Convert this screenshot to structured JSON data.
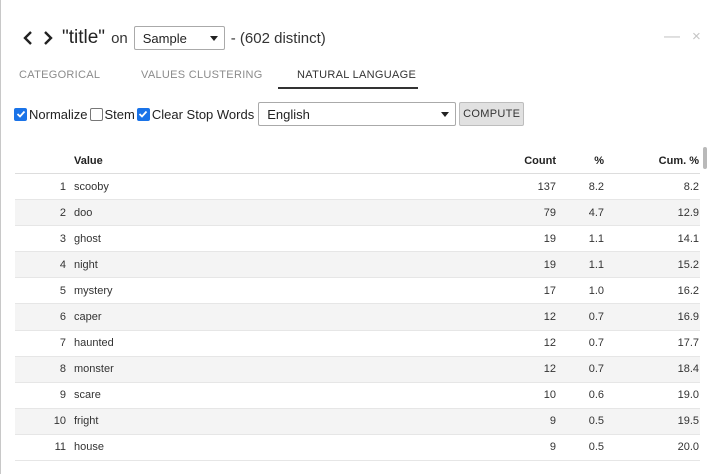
{
  "header": {
    "column_title": "\"title\"",
    "on_word": "on",
    "sample_select": "Sample",
    "distinct_text": "- (602 distinct)",
    "minimize_glyph": "—",
    "close_glyph": "×"
  },
  "tabs": [
    "CATEGORICAL",
    "VALUES CLUSTERING",
    "NATURAL LANGUAGE"
  ],
  "active_tab": "NATURAL LANGUAGE",
  "controls": {
    "normalize": {
      "label": "Normalize",
      "checked": true
    },
    "stem": {
      "label": "Stem",
      "checked": false
    },
    "clear_stop_words": {
      "label": "Clear Stop Words",
      "checked": true
    },
    "language": "English",
    "compute_label": "COMPUTE"
  },
  "table": {
    "headers": {
      "value": "Value",
      "count": "Count",
      "pct": "%",
      "cum": "Cum. %"
    },
    "rows": [
      {
        "idx": "1",
        "value": "scooby",
        "count": "137",
        "pct": "8.2",
        "cum": "8.2"
      },
      {
        "idx": "2",
        "value": "doo",
        "count": "79",
        "pct": "4.7",
        "cum": "12.9"
      },
      {
        "idx": "3",
        "value": "ghost",
        "count": "19",
        "pct": "1.1",
        "cum": "14.1"
      },
      {
        "idx": "4",
        "value": "night",
        "count": "19",
        "pct": "1.1",
        "cum": "15.2"
      },
      {
        "idx": "5",
        "value": "mystery",
        "count": "17",
        "pct": "1.0",
        "cum": "16.2"
      },
      {
        "idx": "6",
        "value": "caper",
        "count": "12",
        "pct": "0.7",
        "cum": "16.9"
      },
      {
        "idx": "7",
        "value": "haunted",
        "count": "12",
        "pct": "0.7",
        "cum": "17.7"
      },
      {
        "idx": "8",
        "value": "monster",
        "count": "12",
        "pct": "0.7",
        "cum": "18.4"
      },
      {
        "idx": "9",
        "value": "scare",
        "count": "10",
        "pct": "0.6",
        "cum": "19.0"
      },
      {
        "idx": "10",
        "value": "fright",
        "count": "9",
        "pct": "0.5",
        "cum": "19.5"
      },
      {
        "idx": "11",
        "value": "house",
        "count": "9",
        "pct": "0.5",
        "cum": "20.0"
      }
    ]
  },
  "colors": {
    "checkbox_accent": "#1a73e8",
    "alt_row": "#f4f4f4"
  }
}
